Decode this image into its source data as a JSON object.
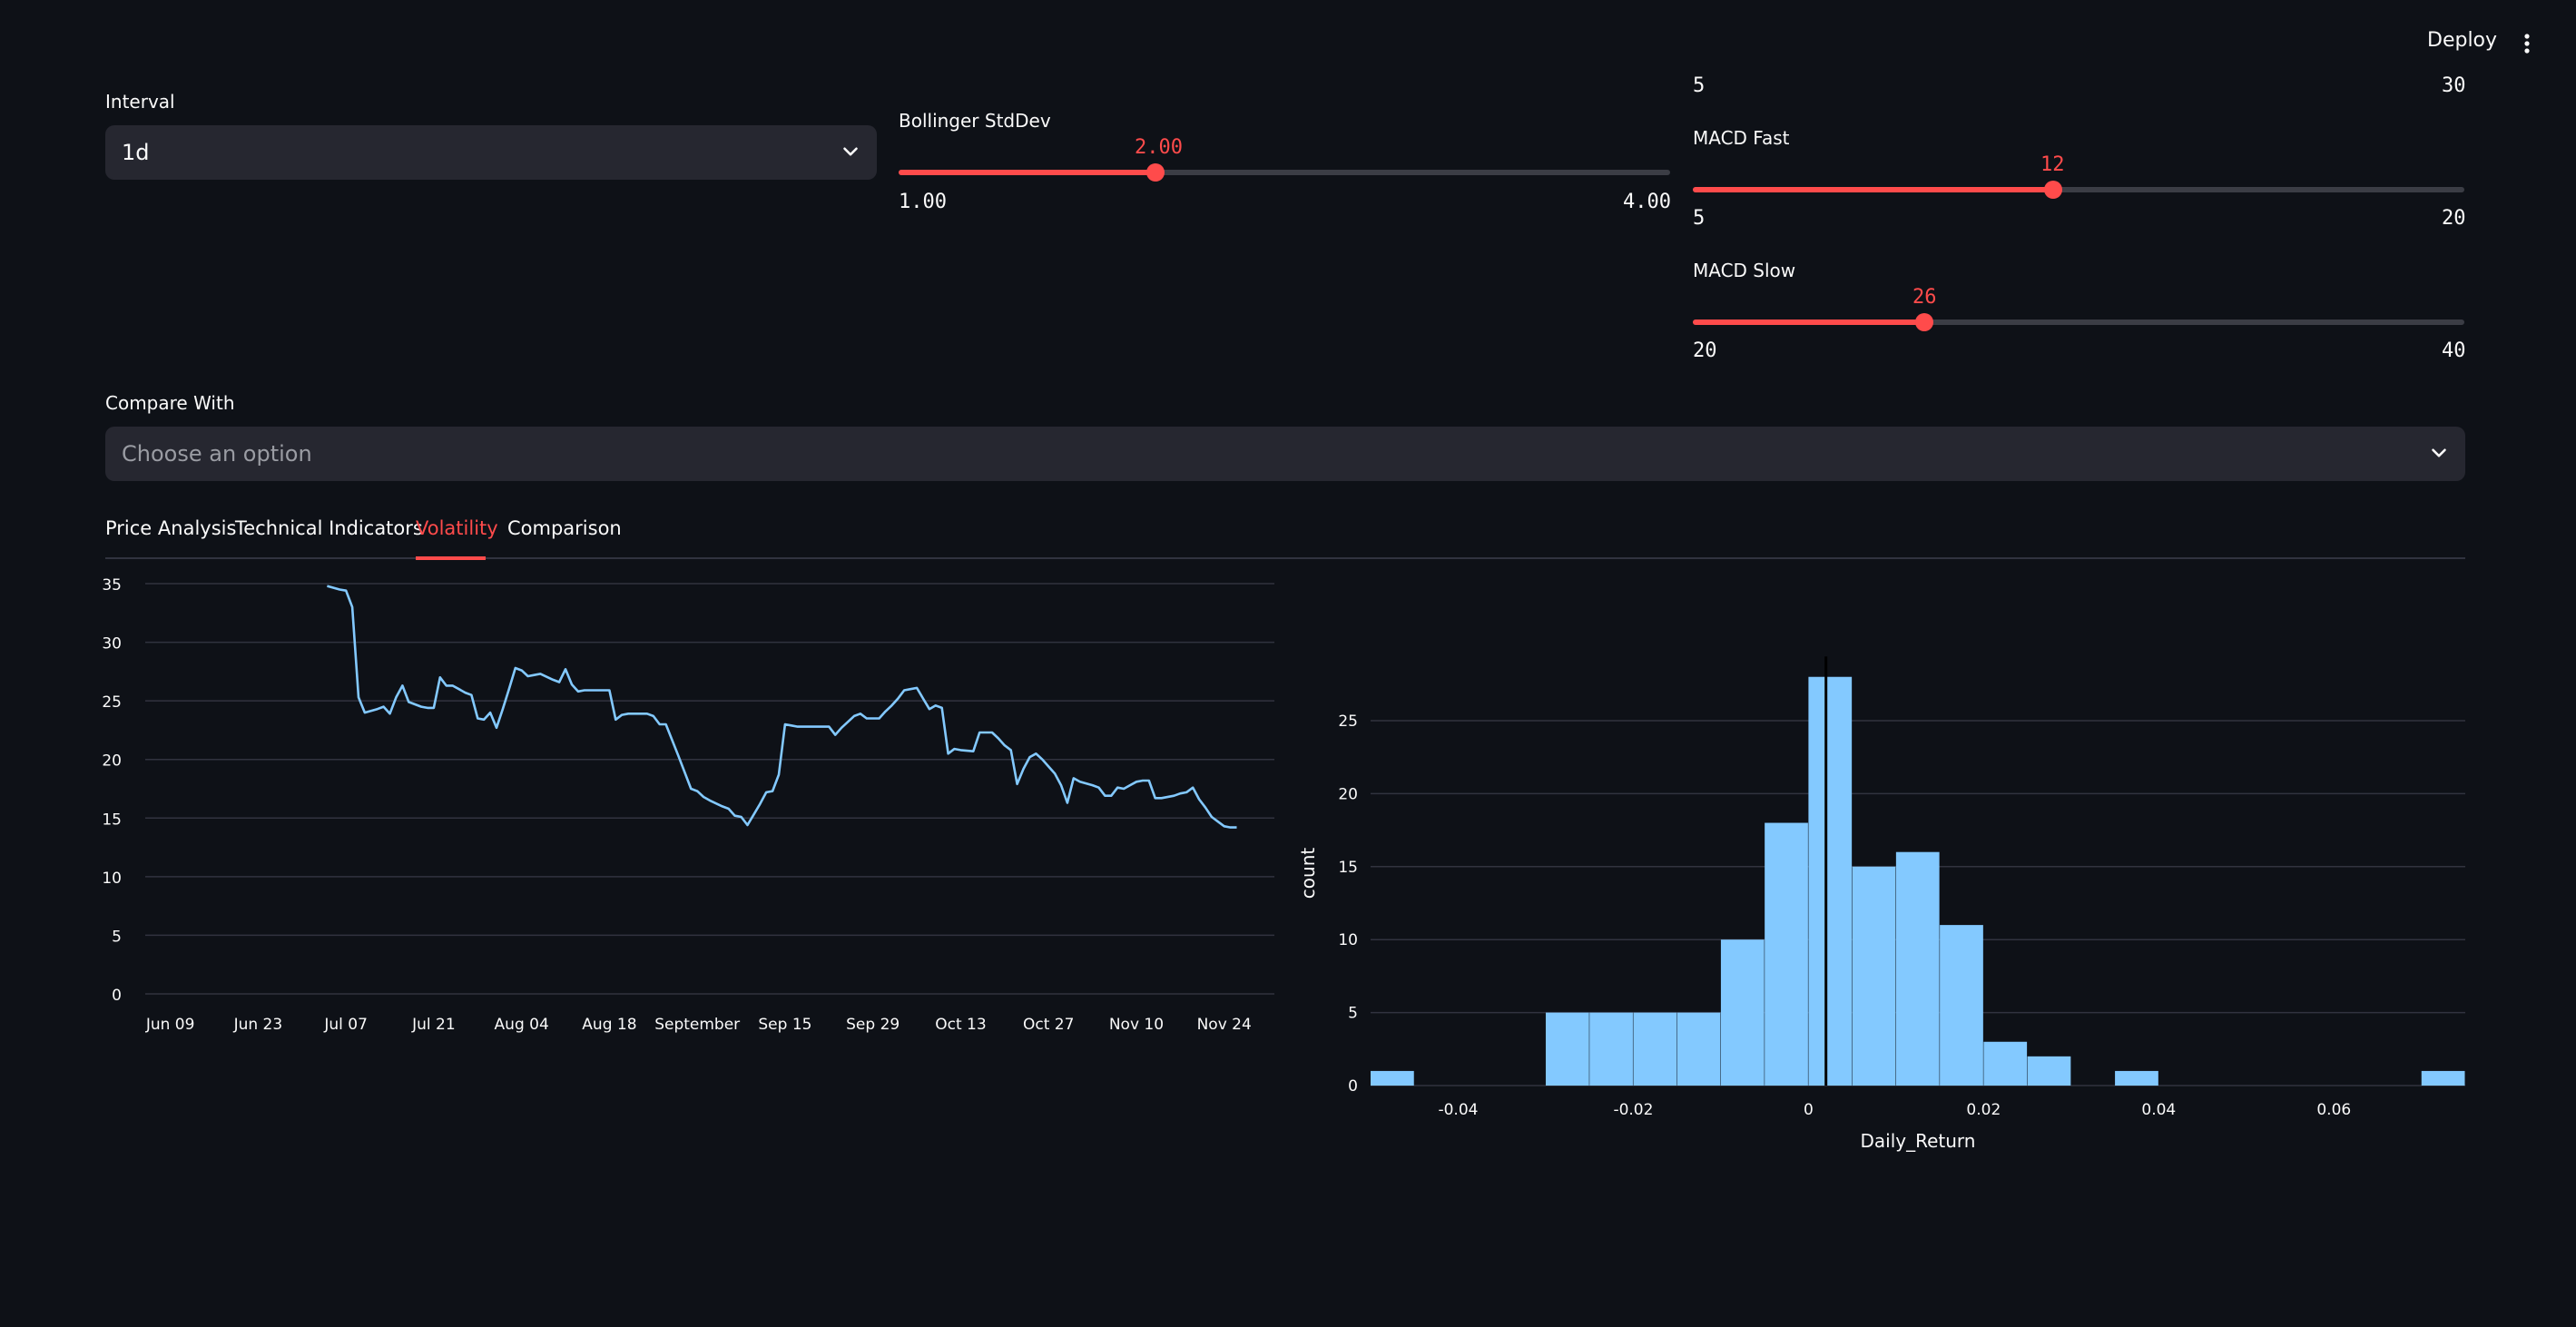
{
  "header": {
    "deploy_label": "Deploy",
    "menu_icon": "kebab-menu-icon"
  },
  "interval": {
    "label": "Interval",
    "value": "1d"
  },
  "top_range": {
    "min": "5",
    "max": "30"
  },
  "bollinger": {
    "label": "Bollinger StdDev",
    "value": "2.00",
    "min": "1.00",
    "max": "4.00",
    "fraction": 0.333
  },
  "macd_fast": {
    "label": "MACD Fast",
    "value": "12",
    "min": "5",
    "max": "20",
    "fraction": 0.467
  },
  "macd_slow": {
    "label": "MACD Slow",
    "value": "26",
    "min": "20",
    "max": "40",
    "fraction": 0.3
  },
  "compare": {
    "label": "Compare With",
    "placeholder": "Choose an option"
  },
  "tabs": [
    {
      "label": "Price Analysis",
      "active": false
    },
    {
      "label": "Technical Indicators",
      "active": false
    },
    {
      "label": "Volatility",
      "active": true
    },
    {
      "label": "Comparison",
      "active": false
    }
  ],
  "colors": {
    "accent": "#ff4b4b",
    "series": "#83c9ff",
    "background": "#0e1117",
    "input": "#262730"
  },
  "chart_data": [
    {
      "type": "line",
      "title": "",
      "xlabel": "",
      "ylabel": "",
      "ylim": [
        0,
        35
      ],
      "y_ticks": [
        "0",
        "5",
        "10",
        "15",
        "20",
        "25",
        "30",
        "35"
      ],
      "x_ticks": [
        "Jun 09",
        "Jun 23",
        "Jul 07",
        "Jul 21",
        "Aug 04",
        "Aug 18",
        "September",
        "Sep 15",
        "Sep 29",
        "Oct 13",
        "Oct 27",
        "Nov 10",
        "Nov 24"
      ],
      "x_tick_days": [
        0,
        14,
        28,
        42,
        56,
        70,
        84,
        98,
        112,
        126,
        140,
        154,
        168
      ],
      "x_range_days": [
        -4,
        176
      ],
      "series": [
        {
          "values": [
            [
              25,
              34.8
            ],
            [
              27,
              34.5
            ],
            [
              28,
              34.4
            ],
            [
              29,
              33
            ],
            [
              30,
              25.3
            ],
            [
              31,
              24
            ],
            [
              33,
              24.3
            ],
            [
              34,
              24.5
            ],
            [
              35,
              23.9
            ],
            [
              36,
              25.3
            ],
            [
              37,
              26.3
            ],
            [
              38,
              24.9
            ],
            [
              40,
              24.5
            ],
            [
              41,
              24.4
            ],
            [
              42,
              24.4
            ],
            [
              43,
              27
            ],
            [
              44,
              26.3
            ],
            [
              45,
              26.3
            ],
            [
              46,
              26
            ],
            [
              47,
              25.7
            ],
            [
              48,
              25.5
            ],
            [
              49,
              23.5
            ],
            [
              50,
              23.4
            ],
            [
              51,
              24
            ],
            [
              52,
              22.7
            ],
            [
              53,
              24.3
            ],
            [
              54,
              26
            ],
            [
              55,
              27.8
            ],
            [
              56,
              27.6
            ],
            [
              57,
              27.1
            ],
            [
              58,
              27.2
            ],
            [
              59,
              27.3
            ],
            [
              61,
              26.8
            ],
            [
              62,
              26.6
            ],
            [
              63,
              27.7
            ],
            [
              64,
              26.4
            ],
            [
              65,
              25.8
            ],
            [
              66,
              25.9
            ],
            [
              70,
              25.9
            ],
            [
              71,
              23.4
            ],
            [
              72,
              23.8
            ],
            [
              73,
              23.9
            ],
            [
              76,
              23.9
            ],
            [
              77,
              23.7
            ],
            [
              78,
              23
            ],
            [
              79,
              23
            ],
            [
              81,
              20.3
            ],
            [
              83,
              17.5
            ],
            [
              84,
              17.3
            ],
            [
              85,
              16.8
            ],
            [
              86,
              16.5
            ],
            [
              88,
              16
            ],
            [
              89,
              15.8
            ],
            [
              90,
              15.2
            ],
            [
              91,
              15.1
            ],
            [
              92,
              14.4
            ],
            [
              93,
              15.3
            ],
            [
              94,
              16.2
            ],
            [
              95,
              17.2
            ],
            [
              96,
              17.3
            ],
            [
              97,
              18.7
            ],
            [
              98,
              23
            ],
            [
              99,
              22.9
            ],
            [
              100,
              22.8
            ],
            [
              105,
              22.8
            ],
            [
              106,
              22.1
            ],
            [
              107,
              22.7
            ],
            [
              108,
              23.2
            ],
            [
              109,
              23.7
            ],
            [
              110,
              23.9
            ],
            [
              111,
              23.5
            ],
            [
              113,
              23.5
            ],
            [
              114,
              24.1
            ],
            [
              115,
              24.6
            ],
            [
              116,
              25.2
            ],
            [
              117,
              25.9
            ],
            [
              118,
              26
            ],
            [
              119,
              26.1
            ],
            [
              120,
              25.2
            ],
            [
              121,
              24.3
            ],
            [
              122,
              24.6
            ],
            [
              123,
              24.4
            ],
            [
              124,
              20.5
            ],
            [
              125,
              20.9
            ],
            [
              126,
              20.8
            ],
            [
              128,
              20.7
            ],
            [
              129,
              22.3
            ],
            [
              131,
              22.3
            ],
            [
              132,
              21.8
            ],
            [
              133,
              21.2
            ],
            [
              134,
              20.8
            ],
            [
              135,
              17.9
            ],
            [
              136,
              19.2
            ],
            [
              137,
              20.2
            ],
            [
              138,
              20.5
            ],
            [
              139,
              20
            ],
            [
              140,
              19.4
            ],
            [
              141,
              18.8
            ],
            [
              142,
              17.8
            ],
            [
              143,
              16.3
            ],
            [
              144,
              18.4
            ],
            [
              145,
              18.1
            ],
            [
              147,
              17.8
            ],
            [
              148,
              17.6
            ],
            [
              149,
              16.9
            ],
            [
              150,
              16.9
            ],
            [
              151,
              17.6
            ],
            [
              152,
              17.5
            ],
            [
              153,
              17.8
            ],
            [
              154,
              18.1
            ],
            [
              155,
              18.2
            ],
            [
              156,
              18.2
            ],
            [
              157,
              16.7
            ],
            [
              158,
              16.7
            ],
            [
              160,
              16.9
            ],
            [
              161,
              17.1
            ],
            [
              162,
              17.2
            ],
            [
              163,
              17.6
            ],
            [
              164,
              16.6
            ],
            [
              165,
              15.9
            ],
            [
              166,
              15.1
            ],
            [
              167,
              14.7
            ],
            [
              168,
              14.3
            ],
            [
              169,
              14.2
            ],
            [
              170,
              14.2
            ]
          ]
        }
      ]
    },
    {
      "type": "bar",
      "title": "",
      "xlabel": "Daily_Return",
      "ylabel": "count",
      "xlim": [
        -0.05,
        0.075
      ],
      "ylim": [
        0,
        29.6
      ],
      "x_ticks": [
        "-0.04",
        "-0.02",
        "0",
        "0.02",
        "0.04",
        "0.06"
      ],
      "x_tick_values": [
        -0.04,
        -0.02,
        0,
        0.02,
        0.04,
        0.06
      ],
      "y_ticks": [
        "0",
        "5",
        "10",
        "15",
        "20",
        "25"
      ],
      "y_tick_values": [
        0,
        5,
        10,
        15,
        20,
        25
      ],
      "bin_width": 0.005,
      "bins": [
        {
          "start": -0.05,
          "count": 1
        },
        {
          "start": -0.03,
          "count": 5
        },
        {
          "start": -0.025,
          "count": 5
        },
        {
          "start": -0.02,
          "count": 5
        },
        {
          "start": -0.015,
          "count": 5
        },
        {
          "start": -0.01,
          "count": 10
        },
        {
          "start": -0.005,
          "count": 18
        },
        {
          "start": 0.0,
          "count": 28
        },
        {
          "start": 0.005,
          "count": 15
        },
        {
          "start": 0.01,
          "count": 16
        },
        {
          "start": 0.015,
          "count": 11
        },
        {
          "start": 0.02,
          "count": 3
        },
        {
          "start": 0.025,
          "count": 2
        },
        {
          "start": 0.035,
          "count": 1
        },
        {
          "start": 0.07,
          "count": 1
        }
      ],
      "reference_line_x": 0.002
    }
  ]
}
